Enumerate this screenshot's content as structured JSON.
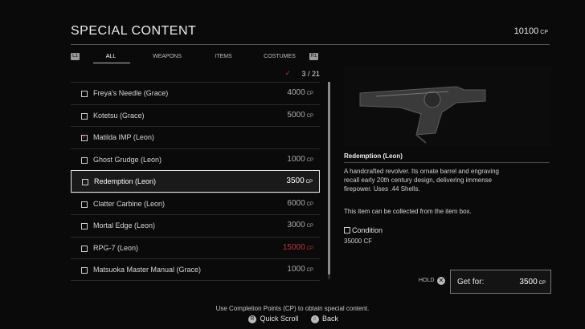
{
  "header": {
    "title": "SPECIAL CONTENT",
    "cp_total": "10100",
    "cp_unit": "CP"
  },
  "tabs": {
    "left_button": "L1",
    "right_button": "R1",
    "items": [
      "ALL",
      "WEAPONS",
      "ITEMS",
      "COSTUMES"
    ],
    "active": "ALL"
  },
  "progress": {
    "collected": "3 / 21"
  },
  "list": [
    {
      "name": "Freya's Needle (Grace)",
      "price": "4000",
      "unit": "CP",
      "checked": false
    },
    {
      "name": "Kotetsu (Grace)",
      "price": "5000",
      "unit": "CP",
      "checked": false
    },
    {
      "name": "Matilda IMP (Leon)",
      "price": "",
      "unit": "",
      "checked": true
    },
    {
      "name": "Ghost Grudge (Leon)",
      "price": "1000",
      "unit": "CP",
      "checked": false
    },
    {
      "name": "Redemption (Leon)",
      "price": "3500",
      "unit": "CP",
      "checked": false,
      "selected": true
    },
    {
      "name": "Clatter Carbine (Leon)",
      "price": "6000",
      "unit": "CP",
      "checked": false
    },
    {
      "name": "Mortal Edge (Leon)",
      "price": "3000",
      "unit": "CP",
      "checked": false
    },
    {
      "name": "RPG-7 (Leon)",
      "price": "15000",
      "unit": "CP",
      "checked": false,
      "unaffordable": true
    },
    {
      "name": "Matsuoka Master Manual (Grace)",
      "price": "1000",
      "unit": "CP",
      "checked": false
    }
  ],
  "detail": {
    "name": "Redemption (Leon)",
    "description": "A handcrafted revolver. Its ornate barrel and engraving recall early 20th century design, delivering immense firepower. Uses .44 Shells.",
    "note": "This item can be collected from the item box.",
    "condition_label": "Condition",
    "condition_value": "35000 CF"
  },
  "purchase": {
    "hold_label": "HOLD",
    "hold_button": "✕",
    "label": "Get for:",
    "price": "3500",
    "unit": "CP"
  },
  "footer": {
    "hint": "Use Completion Points (CP) to obtain special content.",
    "actions": [
      {
        "button": "R",
        "label": "Quick Scroll"
      },
      {
        "button": "○",
        "label": "Back"
      }
    ]
  },
  "colors": {
    "accent_red": "#c0303a",
    "background": "#0a0a0a"
  }
}
